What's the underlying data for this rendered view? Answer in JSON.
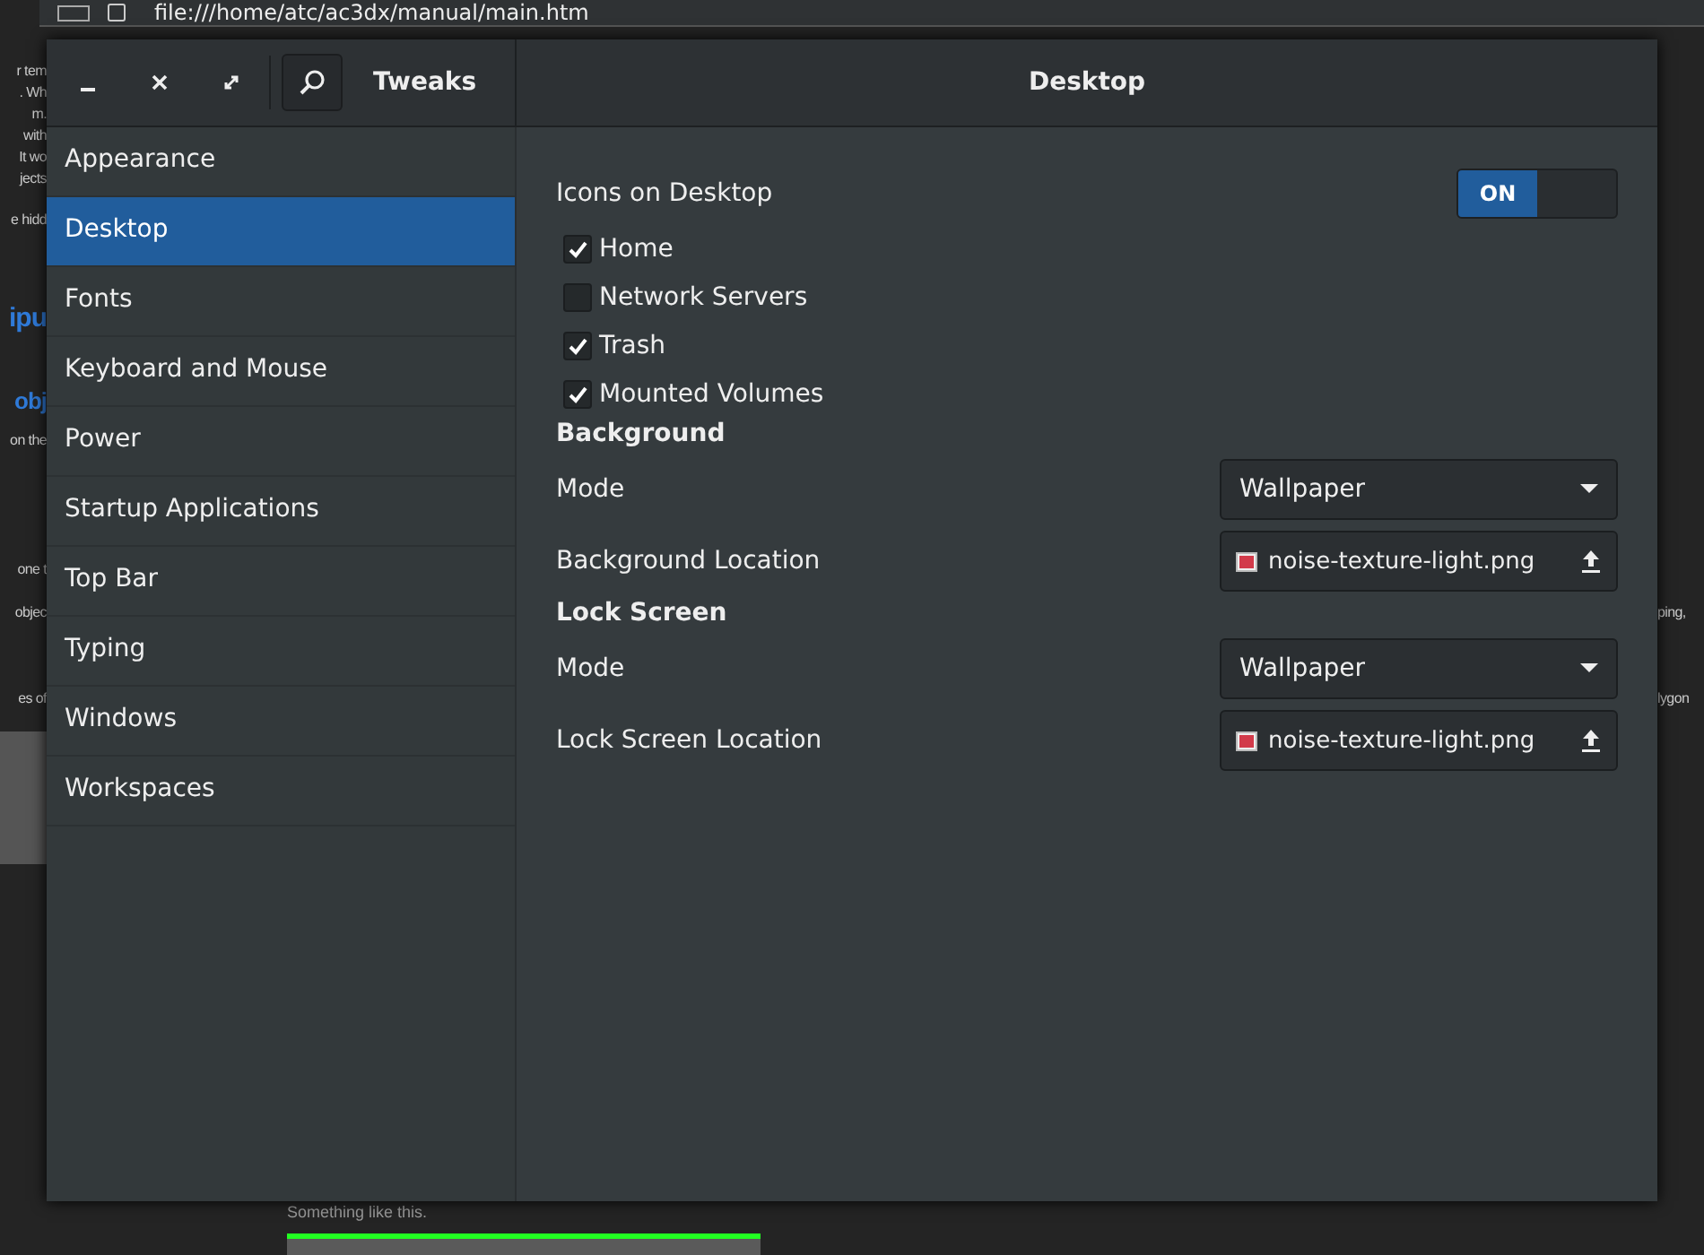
{
  "browser": {
    "url": "file:///home/atc/ac3dx/manual/main.htm"
  },
  "page_fragments_left": [
    {
      "text": "r  tem",
      "kind": "plain"
    },
    {
      "text": ".  Wh",
      "kind": "plain"
    },
    {
      "text": "m.",
      "kind": "plain"
    },
    {
      "text": "with",
      "kind": "plain"
    },
    {
      "text": "It wo",
      "kind": "plain"
    },
    {
      "text": "jects",
      "kind": "plain"
    },
    {
      "text": "e hidd",
      "kind": "plain"
    },
    {
      "text": "ipu",
      "kind": "heading"
    },
    {
      "text": "obj",
      "kind": "subheading"
    },
    {
      "text": "on the",
      "kind": "plain"
    },
    {
      "text": "one t",
      "kind": "plain"
    },
    {
      "text": "objec",
      "kind": "plain"
    },
    {
      "text": "es of",
      "kind": "plain"
    }
  ],
  "page_fragments_right": [
    {
      "text": "ping,"
    },
    {
      "text": "lygon"
    }
  ],
  "page_caption": "Something like this.",
  "window": {
    "app_title": "Tweaks",
    "panel_title": "Desktop"
  },
  "sidebar": {
    "items": [
      {
        "label": "Appearance",
        "selected": false
      },
      {
        "label": "Desktop",
        "selected": true
      },
      {
        "label": "Fonts",
        "selected": false
      },
      {
        "label": "Keyboard and Mouse",
        "selected": false
      },
      {
        "label": "Power",
        "selected": false
      },
      {
        "label": "Startup Applications",
        "selected": false
      },
      {
        "label": "Top Bar",
        "selected": false
      },
      {
        "label": "Typing",
        "selected": false
      },
      {
        "label": "Windows",
        "selected": false
      },
      {
        "label": "Workspaces",
        "selected": false
      }
    ]
  },
  "desktop_icons": {
    "label": "Icons on Desktop",
    "toggle": {
      "label": "ON",
      "on": true
    },
    "items": [
      {
        "label": "Home",
        "checked": true
      },
      {
        "label": "Network Servers",
        "checked": false
      },
      {
        "label": "Trash",
        "checked": true
      },
      {
        "label": "Mounted Volumes",
        "checked": true
      }
    ]
  },
  "sections": [
    {
      "heading": "Background",
      "rows": [
        {
          "kind": "dropdown",
          "label": "Mode",
          "value": "Wallpaper"
        },
        {
          "kind": "file",
          "label": "Background Location",
          "value": "noise-texture-light.png"
        }
      ]
    },
    {
      "heading": "Lock Screen",
      "rows": [
        {
          "kind": "dropdown",
          "label": "Mode",
          "value": "Wallpaper"
        },
        {
          "kind": "file",
          "label": "Lock Screen Location",
          "value": "noise-texture-light.png"
        }
      ]
    }
  ]
}
